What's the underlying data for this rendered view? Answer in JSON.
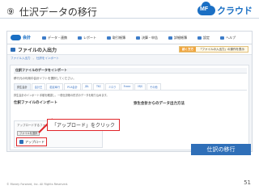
{
  "slide": {
    "number": "⑨",
    "title": "仕沢データの移行",
    "logo_text": "クラウド",
    "logo_mark": "MF"
  },
  "app": {
    "nav": {
      "brand": "会計",
      "items": [
        "データ・連携",
        "レポート",
        "取引帳簿",
        "決算・申告",
        "詳細帳簿",
        "設定"
      ],
      "help": "ヘルプ"
    },
    "page_heading": "ファイルの入出力",
    "notice": {
      "tag": "続く方方",
      "message": "「ファイルの入出力」の操作を表示"
    },
    "breadcrumb": [
      "ファイル入出力",
      "仕訳をインポート"
    ],
    "section_title": "仕訳ファイルのデータをインポート",
    "instruction": "移行元の利用中会計ソフトを選択してください。",
    "tabs": [
      "弥生会計",
      "会計王",
      "勘定奉行",
      "PCA会計",
      "JDL",
      "TKC",
      "ミロク",
      "Freee",
      "MJS",
      "その他"
    ],
    "description": "弥生会計のインポート手順を確認し、一般仕訳帳の形式のデータを取り込めます。",
    "import_heading": "仕訳ファイルのインポート",
    "import_label": "アップロードするファイル",
    "file_button": "ファイルを選択",
    "upload_button": "アップロード",
    "right_heading": "弥生会計からのデータ出力方法"
  },
  "callout": "「アップロード」をクリック",
  "section_badge": "仕訳の移行",
  "footer": {
    "copyright": "© Money Forward, Inc. All Rights Reserved.",
    "page": "51"
  }
}
